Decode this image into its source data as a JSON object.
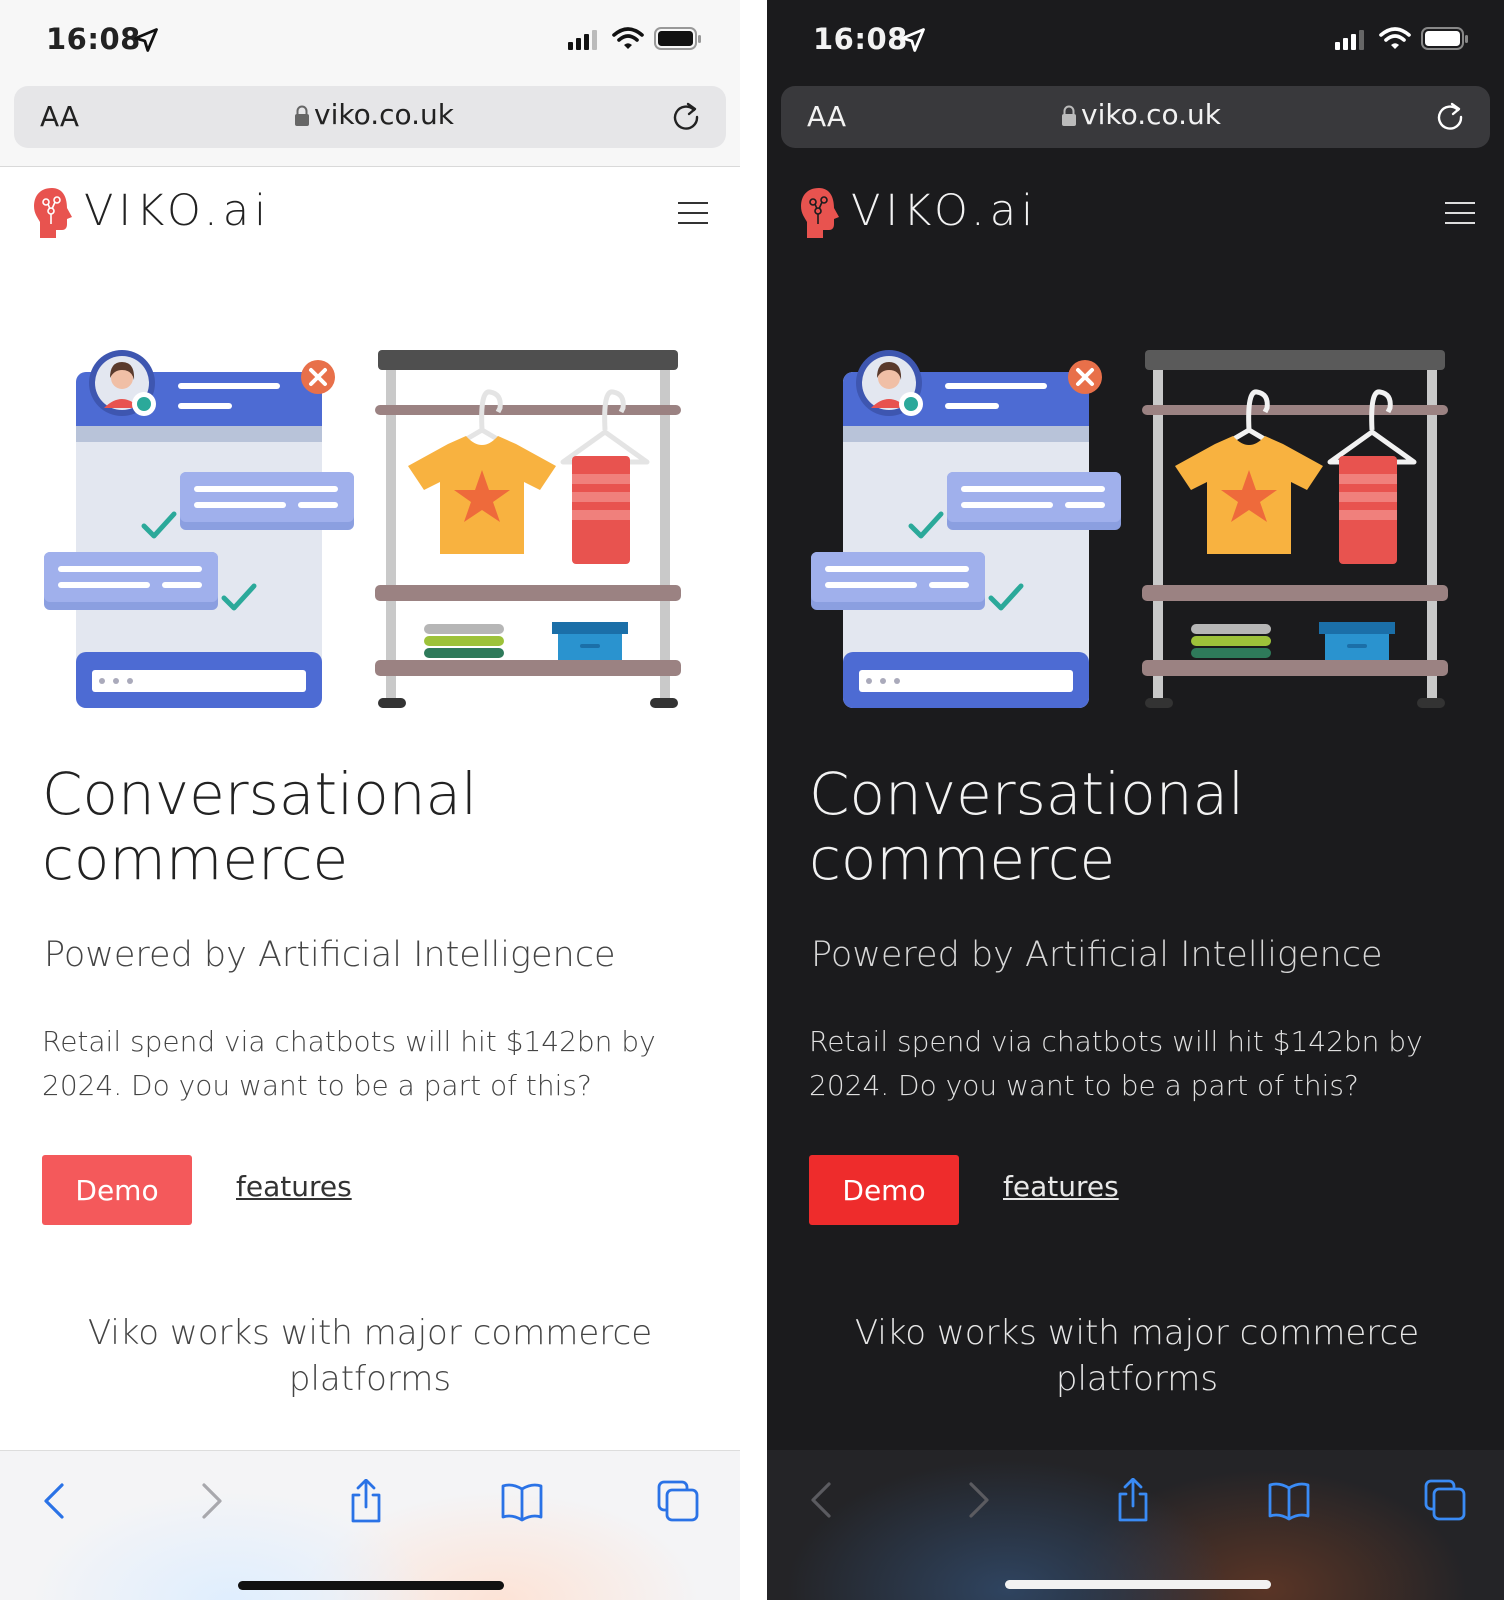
{
  "screens": [
    {
      "theme": "light",
      "status_bar": {
        "time": "16:08"
      },
      "address_bar": {
        "text_size_label": "AA",
        "url": "viko.co.uk"
      },
      "site": {
        "brand": "VIKO.ai",
        "hero_title_line1": "Conversational",
        "hero_title_line2": "commerce",
        "subtitle": "Powered by Artificial Intelligence",
        "body": "Retail spend via chatbots will hit $142bn by 2024.  Do you want to be a part of this?",
        "demo_button": "Demo",
        "features_link": "features",
        "platforms_heading": "Viko works with major commerce platforms"
      },
      "colors": {
        "accent_button": "#f4595b",
        "background": "#ffffff"
      }
    },
    {
      "theme": "dark",
      "status_bar": {
        "time": "16:08"
      },
      "address_bar": {
        "text_size_label": "AA",
        "url": "viko.co.uk"
      },
      "site": {
        "brand": "VIKO.ai",
        "hero_title_line1": "Conversational",
        "hero_title_line2": "commerce",
        "subtitle": "Powered by Artificial Intelligence",
        "body": "Retail spend via chatbots will hit $142bn by 2024.  Do you want to be a part of this?",
        "demo_button": "Demo",
        "features_link": "features",
        "platforms_heading": "Viko works with major commerce platforms"
      },
      "colors": {
        "accent_button": "#ee2c2c",
        "background": "#1b1b1d"
      }
    }
  ],
  "icons": [
    "location-arrow-icon",
    "signal-icon",
    "wifi-icon",
    "battery-icon",
    "lock-icon",
    "reload-icon",
    "brain-logo-icon",
    "hamburger-menu-icon",
    "back-icon",
    "forward-icon",
    "share-icon",
    "bookmarks-icon",
    "tabs-icon"
  ]
}
